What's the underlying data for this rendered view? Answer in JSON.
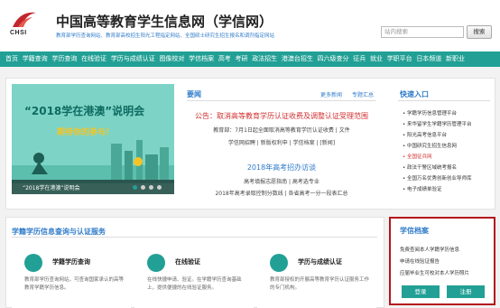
{
  "header": {
    "logo_text": "CHSI",
    "site_title": "中国高等教育学生信息网（学信网）",
    "site_links": "教育部学历查询网站、教育部高校招生阳光工程指定网站、全国硕士研究生招生报名和调剂指定网站",
    "search_placeholder": "站内搜索",
    "search_button": "搜索"
  },
  "nav": [
    "首页",
    "学籍查询",
    "学历查询",
    "在线验证",
    "学历与成绩认证",
    "图像校对",
    "学信档案",
    "高考",
    "考研",
    "政法招生",
    "港澳台招生",
    "四六级查分",
    "征兵",
    "就业",
    "学职平台",
    "日本频道",
    "新职业"
  ],
  "banner": {
    "title": "“2018学在港澳”说明会",
    "subtitle": "期待你的参与！",
    "caption": "“2018学在港澳”说明会"
  },
  "news": {
    "heading": "要闻",
    "more": "更多新闻",
    "topics": "专题汇总",
    "headline": "公告：取消高等教育学历认证收费及调整认证受理范围",
    "line1": "教育部：7月1日起全面取消高等教育学历认证收费 | 文件",
    "line2": "学信网招聘 | 新版权利申 | 学信档案 | [新闻]",
    "blue_title": "2018年高考招办访谈",
    "line3": "高考填报志愿指南 | 高考选专业",
    "line4": "2018年高考录取控制分数线 | 各省高考一分一段表汇总"
  },
  "quick": {
    "heading": "快速入口",
    "items": [
      {
        "label": "• 学籍学历信息管理平台",
        "highlight": false
      },
      {
        "label": "• 来华留学生学籍学历管理平台",
        "highlight": false
      },
      {
        "label": "• 阳光高考信息平台",
        "highlight": false
      },
      {
        "label": "• 中国研究生招生信息网",
        "highlight": false
      },
      {
        "label": "• 全国征兵网",
        "highlight": true
      },
      {
        "label": "• 政法干警区域统考报名",
        "highlight": false
      },
      {
        "label": "• 全国万名优秀创新创业导师库",
        "highlight": false
      },
      {
        "label": "• 电子成绩单验证",
        "highlight": false
      }
    ]
  },
  "services": {
    "section_title": "学籍学历信息查询与认证服务",
    "items": [
      {
        "title": "学籍学历查询",
        "desc": "教育部学历查询网站，可查询国家承认的高等教育学籍学历信息。"
      },
      {
        "title": "在线验证",
        "desc": "在线快捷申请、验证。在学籍学历查询基础上，提供便捷的在线验证服务。"
      },
      {
        "title": "学历与成绩认证",
        "desc": "教育部授权的开展高等教育学历认证服务工作的专门机构。"
      }
    ]
  },
  "archive": {
    "title": "学信档案",
    "items": [
      "免费查阅本人学籍学历信息",
      "申请在线验证报告",
      "应届毕业生可校对本人学历照片"
    ],
    "login": "登录",
    "register": "注册"
  },
  "colors": {
    "nav_bg": "#22a095",
    "link_blue": "#2f7bc9",
    "alert_red": "#d0302f",
    "highlight_border": "#b3161c"
  }
}
